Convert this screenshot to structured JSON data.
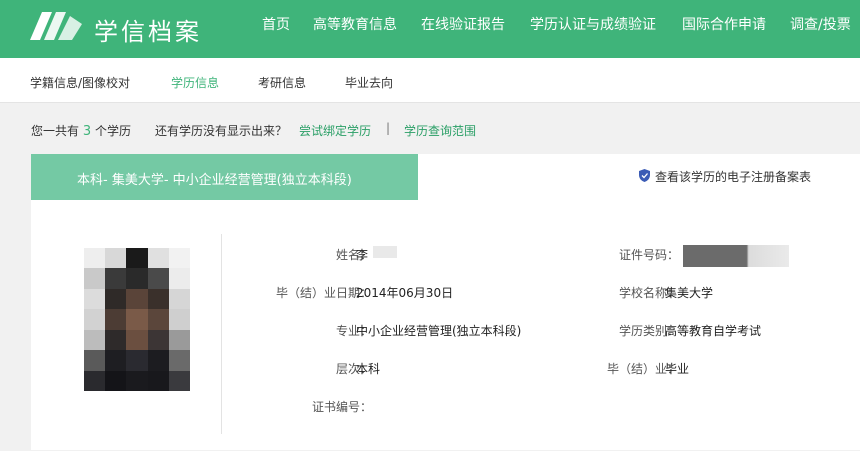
{
  "header": {
    "brand": "学信档案",
    "nav": [
      "首页",
      "高等教育信息",
      "在线验证报告",
      "学历认证与成绩验证",
      "国际合作申请",
      "调查/投票"
    ]
  },
  "subnav": [
    "学籍信息/图像校对",
    "学历信息",
    "考研信息",
    "毕业去向"
  ],
  "summary": {
    "prefix": "您一共有",
    "count": "3",
    "suffix": "个学历",
    "question": "还有学历没有显示出来？",
    "bind_link": "尝试绑定学历",
    "separator": "|",
    "scope_link": "学历查询范围"
  },
  "record": {
    "ribbon_title": "本科- 集美大学- 中小企业经营管理(独立本科段)",
    "verify_link": "查看该学历的电子注册备案表",
    "fields": {
      "name_label": "姓名：",
      "name_value": "李",
      "id_label": "证件号码：",
      "grad_date_label": "毕（结）业日期：",
      "grad_date_value": "2014年06月30日",
      "school_label": "学校名称：",
      "school_value": "集美大学",
      "major_label": "专业：",
      "major_value": "中小企业经营管理(独立本科段)",
      "type_label": "学历类别：",
      "type_value": "高等教育自学考试",
      "level_label": "层次：",
      "level_value": "本科",
      "status_label": "毕（结）业：",
      "status_value": "毕业",
      "cert_label": "证书编号："
    }
  },
  "colors": {
    "brand_green": "#3fb47a",
    "ribbon_green": "#74c9a4",
    "link_green": "#2a9f66"
  }
}
